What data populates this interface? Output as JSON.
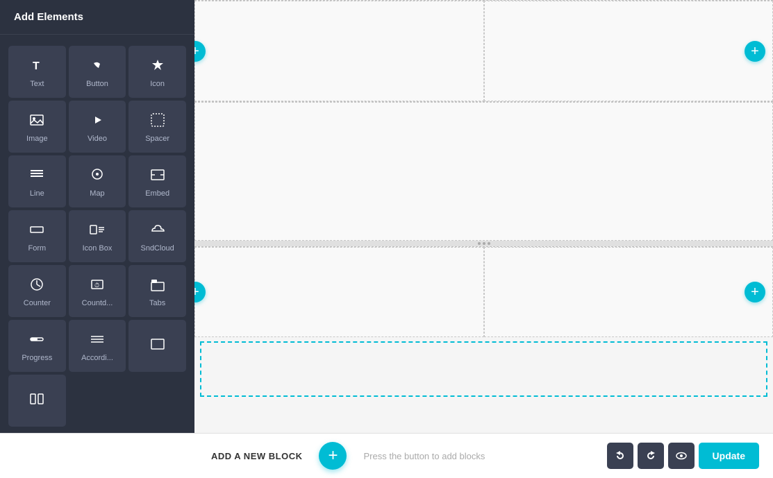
{
  "sidebar": {
    "title": "Add Elements",
    "elements": [
      {
        "id": "text",
        "label": "Text",
        "icon": "T"
      },
      {
        "id": "button",
        "label": "Button",
        "icon": "☝"
      },
      {
        "id": "icon",
        "label": "Icon",
        "icon": "★"
      },
      {
        "id": "image",
        "label": "Image",
        "icon": "🖼"
      },
      {
        "id": "video",
        "label": "Video",
        "icon": "▶"
      },
      {
        "id": "spacer",
        "label": "Spacer",
        "icon": "⊡"
      },
      {
        "id": "line",
        "label": "Line",
        "icon": "≡"
      },
      {
        "id": "map",
        "label": "Map",
        "icon": "◎"
      },
      {
        "id": "embed",
        "label": "Embed",
        "icon": "⬜"
      },
      {
        "id": "form",
        "label": "Form",
        "icon": "▭"
      },
      {
        "id": "icon-box",
        "label": "Icon Box",
        "icon": "⊞"
      },
      {
        "id": "sndcloud",
        "label": "SndCloud",
        "icon": "≋"
      },
      {
        "id": "counter",
        "label": "Counter",
        "icon": "◑"
      },
      {
        "id": "countd",
        "label": "Countd...",
        "icon": "⏱"
      },
      {
        "id": "tabs",
        "label": "Tabs",
        "icon": "📄"
      },
      {
        "id": "progress",
        "label": "Progress",
        "icon": "▱"
      },
      {
        "id": "accordi",
        "label": "Accordi...",
        "icon": "☰"
      },
      {
        "id": "box1",
        "label": "",
        "icon": "⬜"
      },
      {
        "id": "cols",
        "label": "",
        "icon": "⬛"
      }
    ]
  },
  "canvas": {
    "add_button_label": "+",
    "new_block_label": "ADD A NEW BLOCK",
    "new_block_hint": "Press the button to add blocks"
  },
  "toolbar": {
    "undo_label": "↺",
    "redo_label": "↻",
    "preview_label": "👁",
    "update_label": "Update"
  }
}
